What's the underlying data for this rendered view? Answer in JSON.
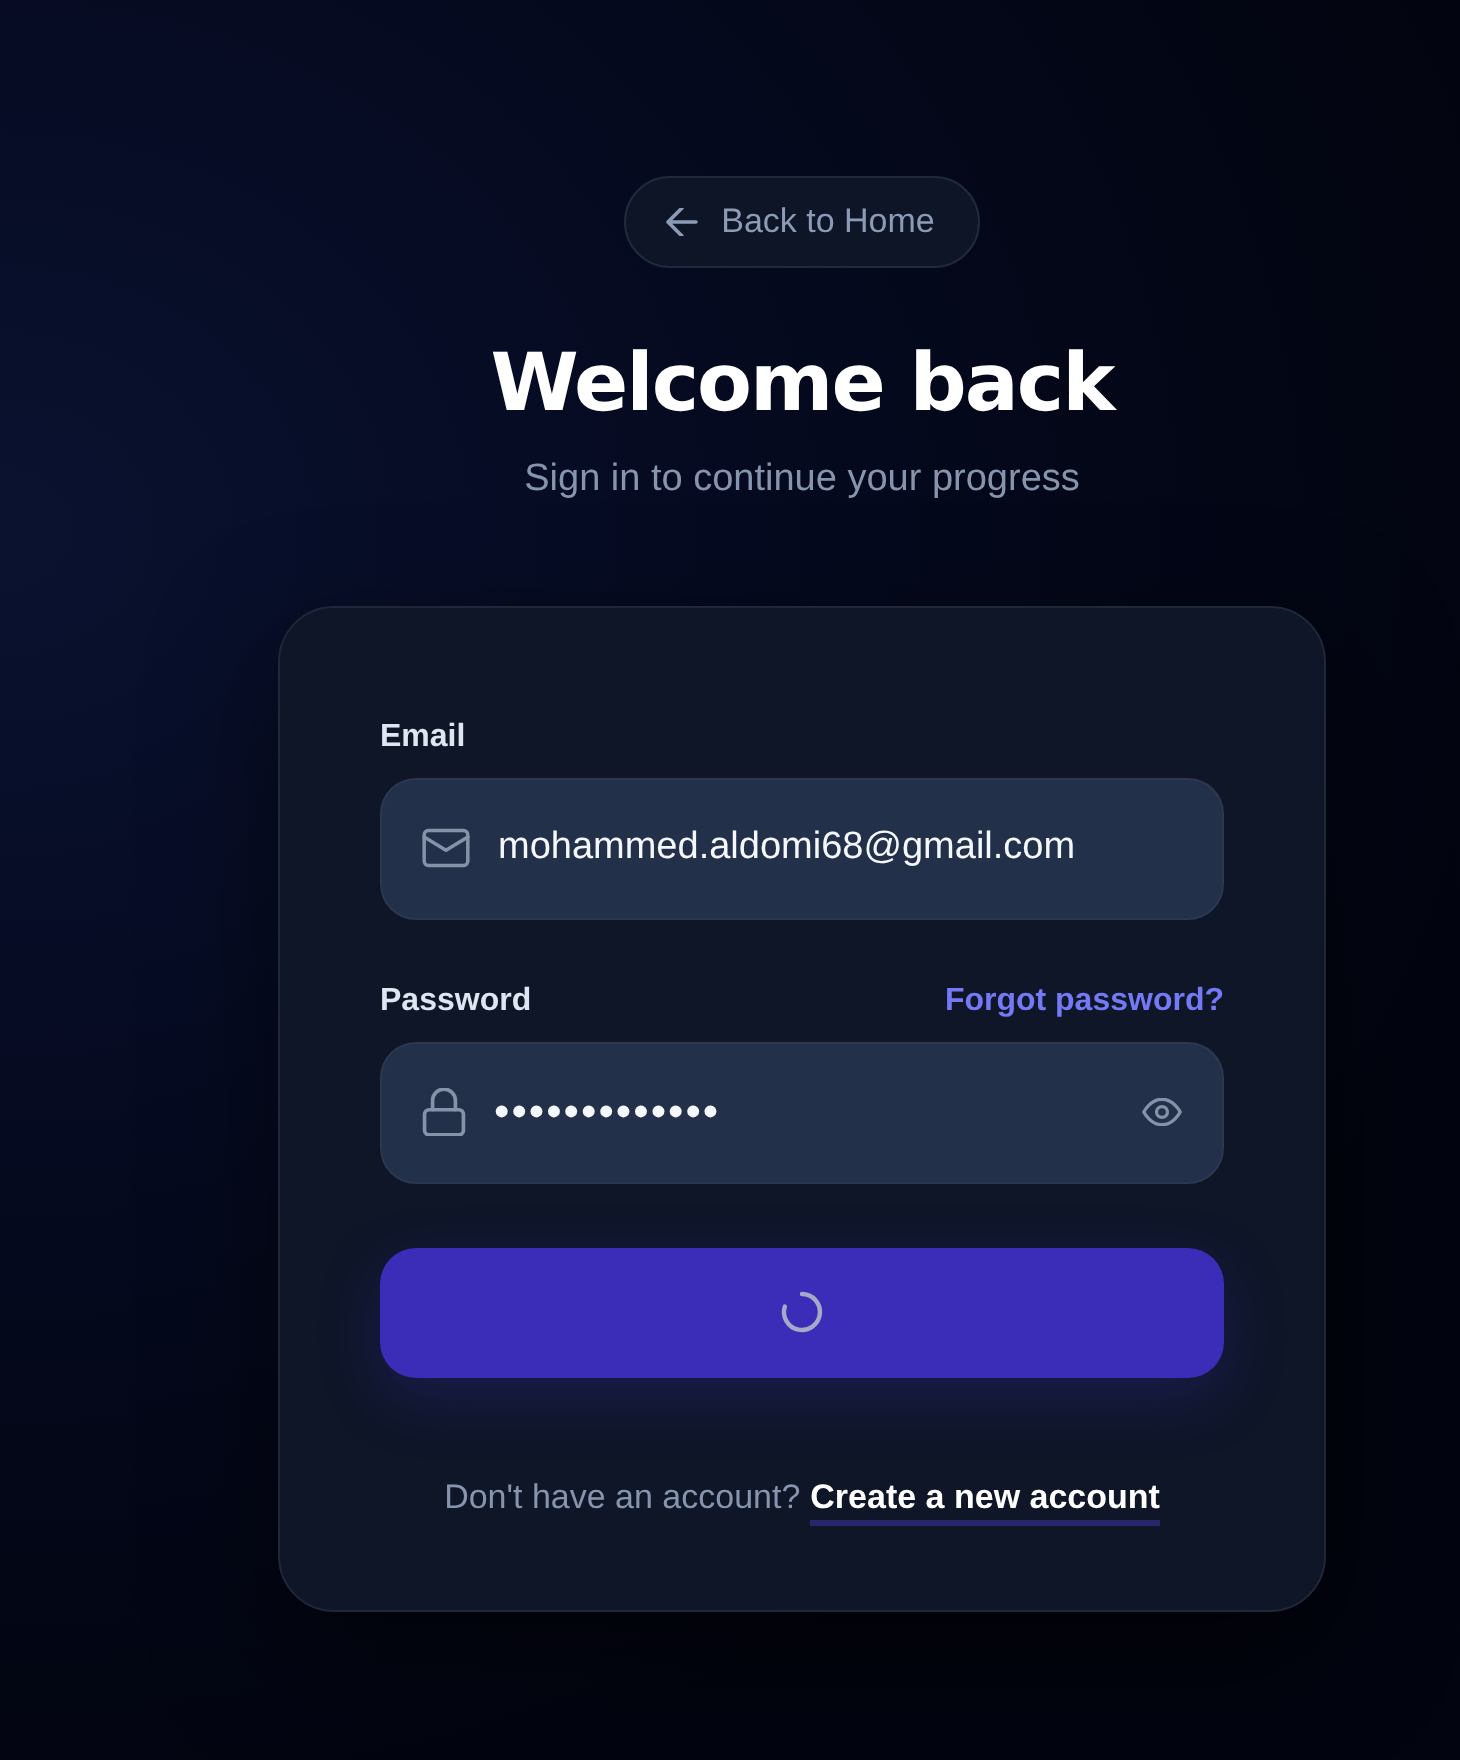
{
  "header": {
    "back_link": "Back to Home",
    "title": "Welcome back",
    "subtitle": "Sign in to continue your progress"
  },
  "form": {
    "fields": [
      {
        "kind": "email",
        "label": "Email",
        "value": "mohammed.aldomi68@gmail.com"
      },
      {
        "kind": "password",
        "label": "Password",
        "value": "•••••••••••••",
        "link": "Forgot password?"
      }
    ],
    "submit": {
      "loading": true
    }
  },
  "footer": {
    "prompt": "Don't have an account?",
    "link": "Create a new account"
  }
}
